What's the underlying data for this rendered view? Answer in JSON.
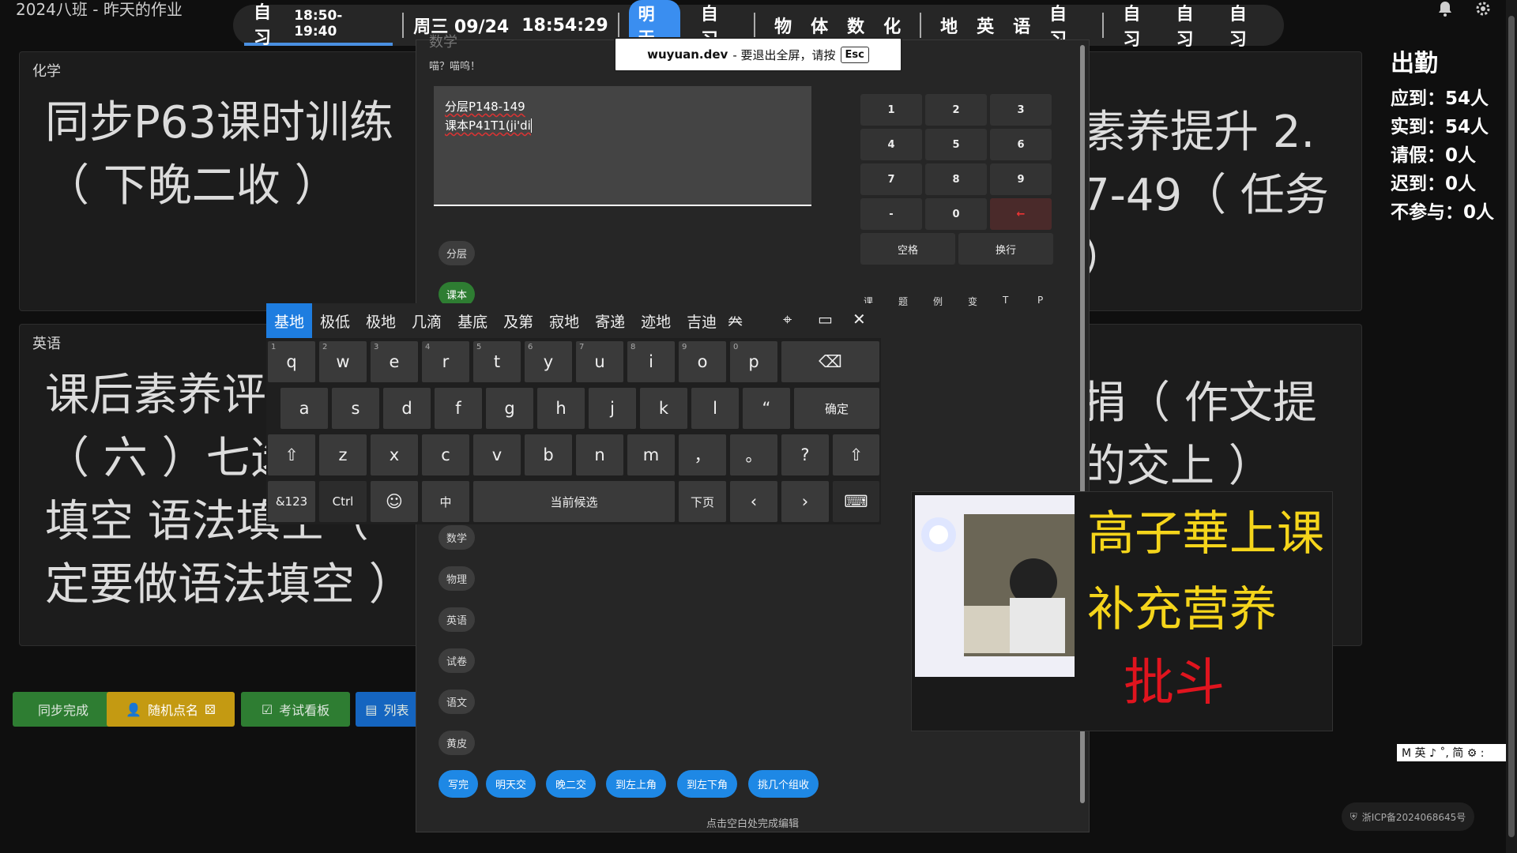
{
  "app_title": "2024八班 - 昨天的作业",
  "schedule": {
    "active_label": "自习",
    "active_time": "18:50-19:40",
    "date": "周三 09/24",
    "clock": "18:54:29",
    "tomorrow_pill": "明天",
    "items_group1": [
      "自习"
    ],
    "items_group2": [
      "物",
      "体",
      "数",
      "化"
    ],
    "items_group3": [
      "地",
      "英",
      "语",
      "自习"
    ],
    "items_group4": [
      "自习",
      "自习",
      "自习"
    ]
  },
  "cards": {
    "chem": {
      "label": "化学",
      "line1": "同步P63课时训练",
      "line2": "（ 下晚二收 ）"
    },
    "eng": {
      "label": "英语",
      "line1": "课后素养评",
      "line2": "（ 六 ）七选",
      "line3": "填空 语法填空（",
      "line4": "定要做语法填空 ）"
    },
    "right_top": {
      "line1": "素养提升 2.",
      "line2": "7-49（ 任务",
      "line3": "）"
    },
    "right_bottom": {
      "line1": "捐（ 作文提",
      "line2": "的交上 ）"
    }
  },
  "attendance": {
    "title": "出勤",
    "rows": [
      "应到：54人",
      "实到：54人",
      "请假：0人",
      "迟到：0人",
      "不参与：0人"
    ]
  },
  "bottom_buttons": {
    "sync_done": "同步完成",
    "random_call": "随机点名",
    "exam_board": "考试看板",
    "list": "列表"
  },
  "editor": {
    "subject": "数学",
    "subtitle": "喵？喵呜！",
    "text_line1": "分层P148-149",
    "text_line2": "课本P41T1(ji'di",
    "chips_gray": [
      "分层",
      "数学",
      "物理",
      "英语",
      "试卷",
      "语文",
      "黄皮"
    ],
    "chip_green": "课本",
    "quick_tags": [
      "写完",
      "明天交",
      "晚二交",
      "到左上角",
      "到左下角",
      "挑几个组收"
    ],
    "numpad": [
      "1",
      "2",
      "3",
      "4",
      "5",
      "6",
      "7",
      "8",
      "9",
      "-",
      "0",
      "←"
    ],
    "space_label": "空格",
    "newline_label": "换行",
    "mini_tabs": [
      "课",
      "题",
      "例",
      "变",
      "T",
      "P"
    ],
    "footer": "点击空白处完成编辑"
  },
  "toast": {
    "site": "wuyuan.dev",
    "message": " - 要退出全屏，请按",
    "key": "Esc"
  },
  "keyboard": {
    "candidates": [
      "基地",
      "极低",
      "极地",
      "几滴",
      "基底",
      "及第",
      "寂地",
      "寄递",
      "迹地",
      "吉迪",
      "𠔉"
    ],
    "row1": [
      "q",
      "w",
      "e",
      "r",
      "t",
      "y",
      "u",
      "i",
      "o",
      "p"
    ],
    "row1_nums": [
      "1",
      "2",
      "3",
      "4",
      "5",
      "6",
      "7",
      "8",
      "9",
      "0"
    ],
    "row2": [
      "a",
      "s",
      "d",
      "f",
      "g",
      "h",
      "j",
      "k",
      "l",
      "“"
    ],
    "enter_label": "确定",
    "row3": [
      "z",
      "x",
      "c",
      "v",
      "b",
      "n",
      "m",
      "，",
      "。",
      "?"
    ],
    "sym_label": "&123",
    "ctrl_label": "Ctrl",
    "lang_label": "中",
    "space_label": "当前候选",
    "next_page_label": "下页"
  },
  "sticker": {
    "ink_line1": "高子華上课",
    "ink_line2": "补充营养",
    "ink_line3": "批斗"
  },
  "ime_indicator": "M 英 ♪ ˚, 简 ⚙ :",
  "icp": "浙ICP备2024068645号",
  "colors": {
    "accent_blue": "#1e88e5",
    "green": "#2e7d32",
    "yellow": "#c9a227",
    "ink_yellow": "#f5d51b",
    "ink_red": "#e0141e"
  }
}
